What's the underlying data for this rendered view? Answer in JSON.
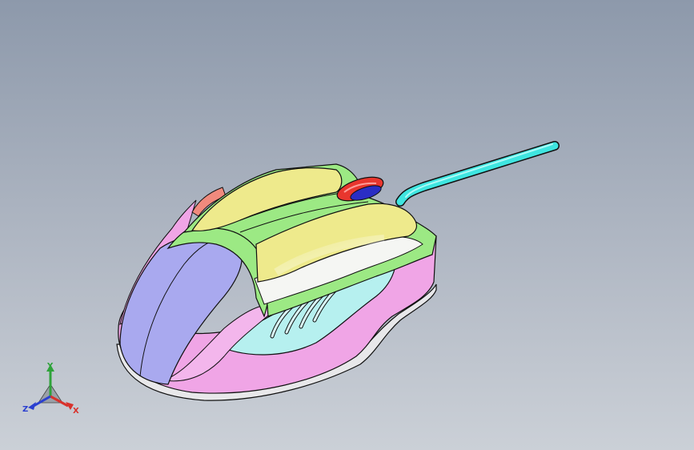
{
  "viewport": {
    "background_top": "#8d99ab",
    "background_bottom": "#cbd0d7"
  },
  "model": {
    "part_colors": {
      "top_shell": "#eeea8c",
      "side_trim": "#9ce984",
      "palm_rest": "#a9a9ef",
      "side_body": "#f0a5e6",
      "side_panel": "#b6f0ef",
      "wheel": "#e8362e",
      "wheel_inner": "#2a2dc4",
      "cable": "#3fe5e0",
      "base": "#e8e8ea",
      "rear_button": "#f08a7d"
    }
  },
  "triad": {
    "icon": "coordinate-triad-icon",
    "x_label": "X",
    "y_label": "Y",
    "z_label": "Z",
    "x_color": "#d8322c",
    "y_color": "#2fa33a",
    "z_color": "#2a3fd0"
  }
}
